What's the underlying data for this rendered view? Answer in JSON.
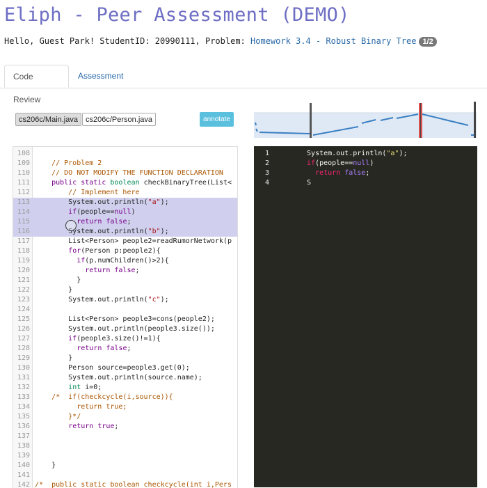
{
  "title": "Eliph - Peer Assessment (DEMO)",
  "greeting": {
    "prefix": "Hello, Guest Park! StudentID: 20990111, Problem: ",
    "problem_link": "Homework 3.4 - Robust Binary Tree",
    "badge": "1/2"
  },
  "tabs": [
    "Code Review",
    "Assessment"
  ],
  "files": [
    "cs206c/Main.java",
    "cs206c/Person.java"
  ],
  "annotate_label": "annotate",
  "colors": {
    "title": "#6e6ec4",
    "link": "#2a6aa8",
    "annotate": "#5bc0de",
    "selection": "#d0d0ee",
    "comment": "#aa5500",
    "keyword": "#770088",
    "type": "#008855",
    "string": "#aa1111",
    "panel_bg": "#272822",
    "panel_keyword": "#f92672",
    "panel_atom": "#ae81ff",
    "panel_string": "#e6db74"
  },
  "code_lines": [
    {
      "n": "108",
      "t": []
    },
    {
      "n": "109",
      "t": [
        [
          "    // Problem 2",
          "c"
        ]
      ]
    },
    {
      "n": "110",
      "t": [
        [
          "    // DO NOT MODIFY THE FUNCTION DECLARATION",
          "c"
        ]
      ]
    },
    {
      "n": "111",
      "t": [
        [
          "    ",
          ""
        ],
        [
          "public static ",
          "k"
        ],
        [
          "boolean ",
          "t"
        ],
        [
          "checkBinaryTree(List<",
          ""
        ]
      ]
    },
    {
      "n": "112",
      "t": [
        [
          "        // Implement here",
          "c"
        ]
      ]
    },
    {
      "n": "113",
      "hl": true,
      "t": [
        [
          "        System.out.println(",
          ""
        ],
        [
          "\"a\"",
          "s"
        ],
        [
          ");",
          ""
        ]
      ]
    },
    {
      "n": "114",
      "hl": true,
      "t": [
        [
          "        ",
          ""
        ],
        [
          "if",
          "k"
        ],
        [
          "(people==",
          ""
        ],
        [
          "null",
          "a"
        ],
        [
          ")",
          ""
        ]
      ]
    },
    {
      "n": "115",
      "hl": true,
      "t": [
        [
          "          ",
          ""
        ],
        [
          "return false",
          "k"
        ],
        [
          ";",
          ""
        ]
      ]
    },
    {
      "n": "116",
      "hl": true,
      "t": [
        [
          "        System.out.println(",
          ""
        ],
        [
          "\"b\"",
          "s"
        ],
        [
          ");",
          ""
        ]
      ]
    },
    {
      "n": "117",
      "t": [
        [
          "        List<Person> people2=readRumorNetwork(p",
          ""
        ]
      ]
    },
    {
      "n": "118",
      "t": [
        [
          "        ",
          ""
        ],
        [
          "for",
          "k"
        ],
        [
          "(Person p:people2){",
          ""
        ]
      ]
    },
    {
      "n": "119",
      "t": [
        [
          "          ",
          ""
        ],
        [
          "if",
          "k"
        ],
        [
          "(p.numChildren()>2){",
          ""
        ]
      ]
    },
    {
      "n": "120",
      "t": [
        [
          "            ",
          ""
        ],
        [
          "return false",
          "k"
        ],
        [
          ";",
          ""
        ]
      ]
    },
    {
      "n": "121",
      "t": [
        [
          "          }",
          ""
        ]
      ]
    },
    {
      "n": "122",
      "t": [
        [
          "        }",
          ""
        ]
      ]
    },
    {
      "n": "123",
      "t": [
        [
          "        System.out.println(",
          ""
        ],
        [
          "\"c\"",
          "s"
        ],
        [
          ");",
          ""
        ]
      ]
    },
    {
      "n": "124",
      "t": []
    },
    {
      "n": "125",
      "t": [
        [
          "        List<Person> people3=cons(people2);",
          ""
        ]
      ]
    },
    {
      "n": "126",
      "t": [
        [
          "        System.out.println(people3.size());",
          ""
        ]
      ]
    },
    {
      "n": "127",
      "t": [
        [
          "        ",
          ""
        ],
        [
          "if",
          "k"
        ],
        [
          "(people3.size()!=1){",
          ""
        ]
      ]
    },
    {
      "n": "128",
      "t": [
        [
          "          ",
          ""
        ],
        [
          "return false",
          "k"
        ],
        [
          ";",
          ""
        ]
      ]
    },
    {
      "n": "129",
      "t": [
        [
          "        }",
          ""
        ]
      ]
    },
    {
      "n": "130",
      "t": [
        [
          "        Person source=people3.get(0);",
          ""
        ]
      ]
    },
    {
      "n": "131",
      "t": [
        [
          "        System.out.println(source.name);",
          ""
        ]
      ]
    },
    {
      "n": "132",
      "t": [
        [
          "        ",
          ""
        ],
        [
          "int ",
          "t"
        ],
        [
          "i=0;",
          ""
        ]
      ]
    },
    {
      "n": "133",
      "t": [
        [
          "    /*  if(checkcycle(i,source)){",
          "c"
        ]
      ]
    },
    {
      "n": "134",
      "t": [
        [
          "          return true;",
          "c"
        ]
      ]
    },
    {
      "n": "135",
      "t": [
        [
          "        }*/",
          "c"
        ]
      ]
    },
    {
      "n": "136",
      "t": [
        [
          "        ",
          ""
        ],
        [
          "return true",
          "k"
        ],
        [
          ";",
          ""
        ]
      ]
    },
    {
      "n": "137",
      "t": []
    },
    {
      "n": "138",
      "t": []
    },
    {
      "n": "139",
      "t": []
    },
    {
      "n": "140",
      "t": [
        [
          "    }",
          ""
        ]
      ]
    },
    {
      "n": "141",
      "t": []
    },
    {
      "n": "142",
      "t": [
        [
          "/*  public static boolean checkcycle(int i,Pers",
          "c"
        ]
      ]
    }
  ],
  "annotation_lines": [
    {
      "n": "1",
      "t": [
        [
          "System.out.println(",
          ""
        ],
        [
          "\"a\"",
          "s"
        ],
        [
          ");",
          ""
        ]
      ]
    },
    {
      "n": "2",
      "t": [
        [
          "if",
          "k"
        ],
        [
          "(people==",
          ""
        ],
        [
          "null",
          "a"
        ],
        [
          ")",
          ""
        ]
      ]
    },
    {
      "n": "3",
      "t": [
        [
          "  ",
          ""
        ],
        [
          "return ",
          "k"
        ],
        [
          "false",
          "a"
        ],
        [
          ";",
          ""
        ]
      ]
    },
    {
      "n": "4",
      "t": [
        [
          "S",
          ""
        ]
      ]
    }
  ]
}
